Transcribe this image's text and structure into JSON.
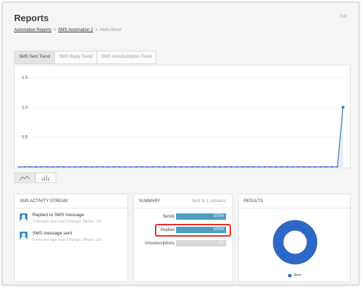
{
  "header": {
    "title": "Reports",
    "edit_label": "Edit"
  },
  "breadcrumb": {
    "items": [
      "Automation Reports",
      "SMS Automation 2"
    ],
    "separator": ">",
    "current": "Hello there!"
  },
  "tabs": [
    {
      "label": "SMS Sent Trend",
      "active": true
    },
    {
      "label": "SMS Reply Trend",
      "active": false
    },
    {
      "label": "SMS Unsubscription Trend",
      "active": false
    }
  ],
  "chart_data": {
    "type": "area",
    "y_ticks": [
      "1.5",
      "1.0",
      "0.5"
    ],
    "ylim": [
      0,
      1.5
    ],
    "series": [
      {
        "values": [
          0,
          0,
          0,
          0,
          0,
          0,
          0,
          0,
          0,
          0,
          0,
          0,
          0,
          0,
          0,
          0,
          0,
          0,
          0,
          0,
          0,
          0,
          0,
          0,
          0,
          0,
          0,
          0,
          0,
          0,
          0,
          0,
          0,
          0,
          0,
          0,
          0,
          0,
          0,
          0,
          0,
          0,
          0,
          0,
          0,
          0,
          0,
          0,
          0,
          0,
          0,
          0,
          0,
          0,
          0,
          0,
          0,
          0,
          1
        ]
      }
    ],
    "color": "#3d6fd1",
    "grid": true
  },
  "view_toggles": [
    {
      "icon": "line-chart-icon",
      "active": true
    },
    {
      "icon": "bar-chart-icon",
      "active": false
    }
  ],
  "activity": {
    "title": "SMS ACTIVITY STREAM",
    "items": [
      {
        "icon": "user-avatar-icon",
        "title": "Replied to SMS message",
        "meta": "2 minutes ago near Chicago, Illinois, US"
      },
      {
        "icon": "user-avatar-icon",
        "title": "SMS message sent",
        "meta": "5 minutes ago near Chicago, Illinois, US"
      }
    ]
  },
  "summary": {
    "title": "SUMMARY",
    "subtitle": "Sent to 1 contacts.",
    "rows": [
      {
        "label": "Sends",
        "value": "100%",
        "fraction": 1
      },
      {
        "label": "Replies",
        "value": "100%",
        "fraction": 1
      },
      {
        "label": "Unsubscriptions",
        "value": "0%",
        "fraction": 0
      }
    ]
  },
  "results": {
    "title": "RESULTS",
    "legend": "Sent",
    "color": "#2e68c6"
  }
}
